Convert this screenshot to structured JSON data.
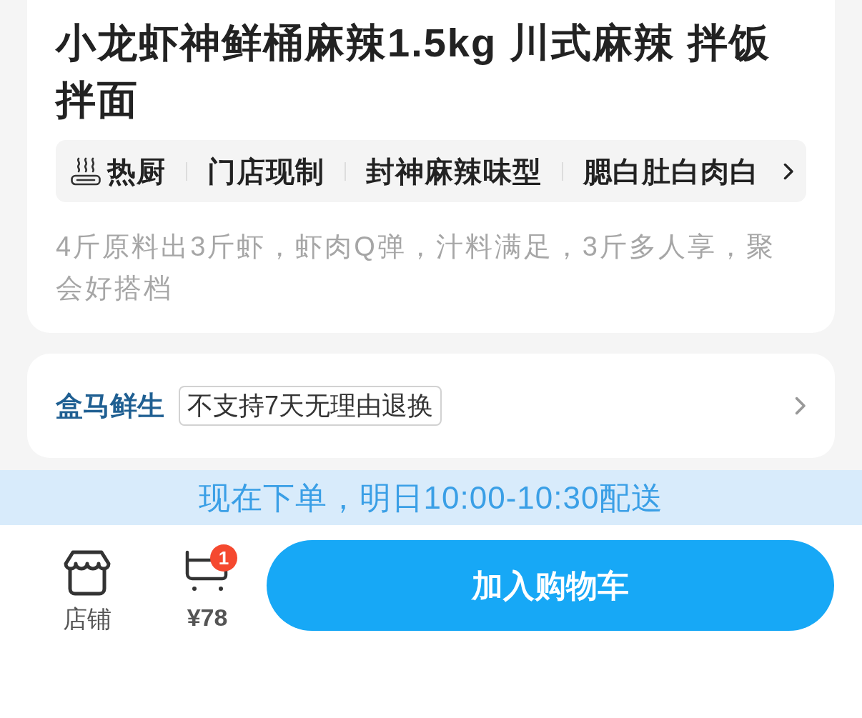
{
  "product": {
    "title": "小龙虾神鲜桶麻辣1.5kg 川式麻辣 拌饭拌面",
    "tags": [
      {
        "kind": "featured",
        "label": "热厨"
      },
      {
        "kind": "plain",
        "label": "门店现制"
      },
      {
        "kind": "plain",
        "label": "封神麻辣味型"
      },
      {
        "kind": "plain",
        "label": "腮白肚白肉白"
      }
    ],
    "description": "4斤原料出3斤虾，虾肉Q弹，汁料满足，3斤多人享，聚会好搭档"
  },
  "store": {
    "logo": "盒马鲜生",
    "policy_badge": "不支持7天无理由退换"
  },
  "delivery_banner": "现在下单，明日10:00-10:30配送",
  "bottom_bar": {
    "shop_label": "店铺",
    "cart": {
      "count": "1",
      "price": "¥78"
    },
    "add_to_cart_button": "加入购物车"
  }
}
